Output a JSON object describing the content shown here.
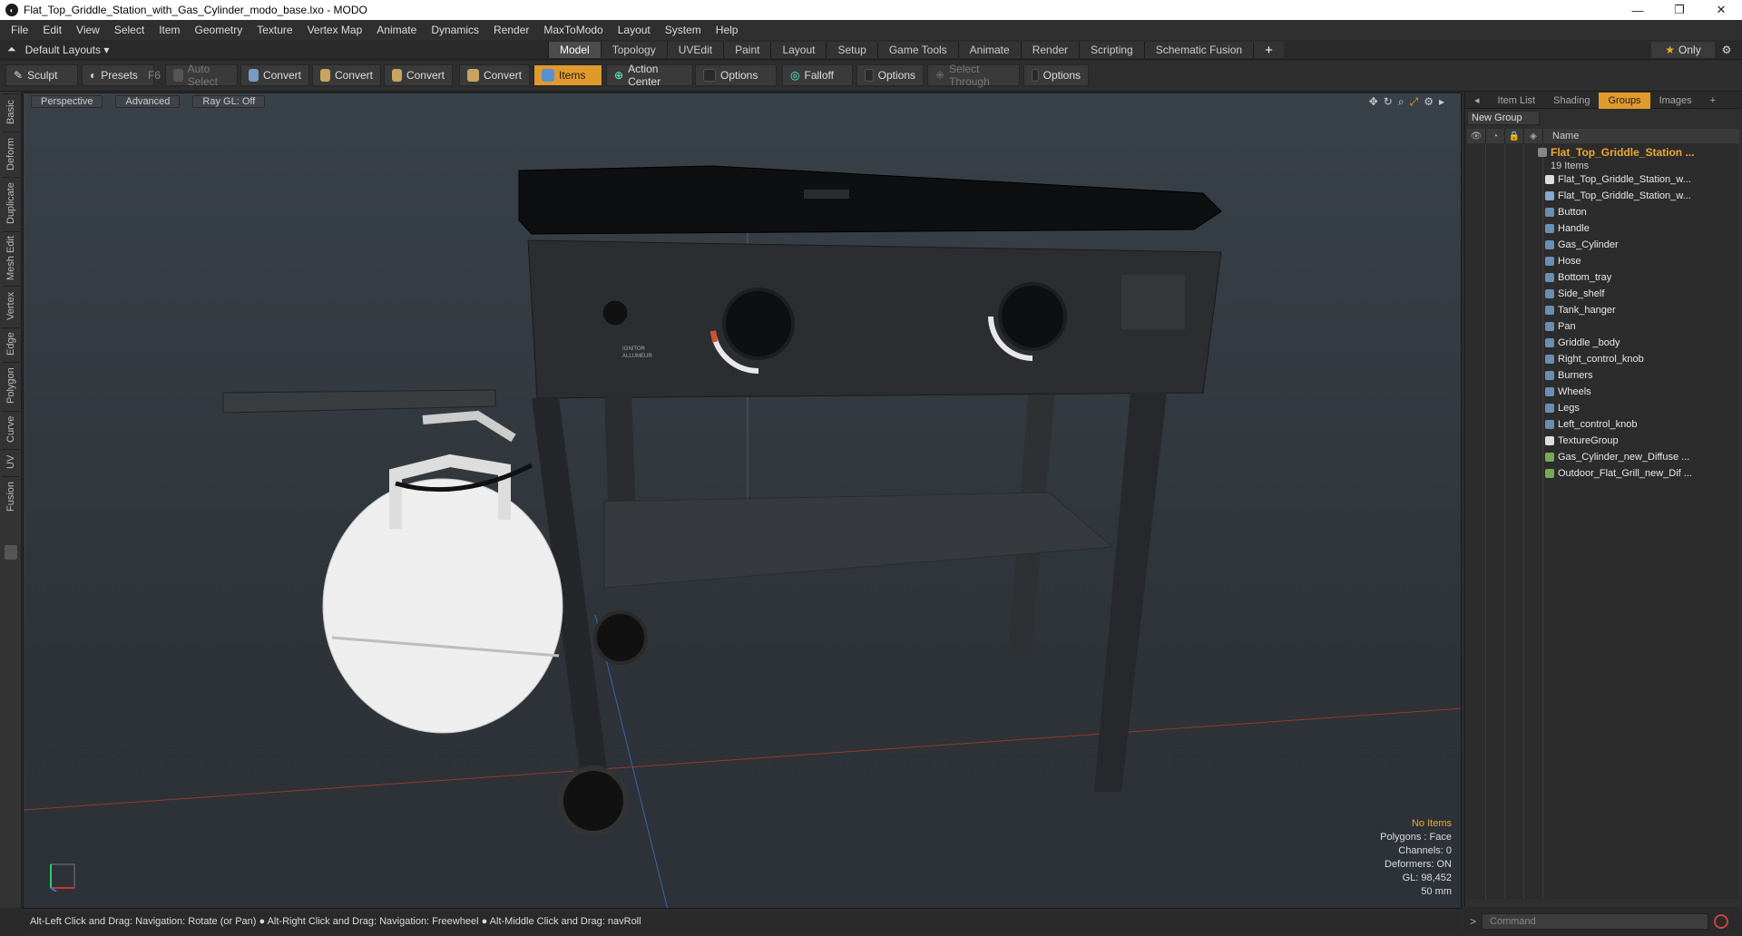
{
  "window": {
    "title": "Flat_Top_Griddle_Station_with_Gas_Cylinder_modo_base.lxo - MODO",
    "controls": [
      "—",
      "❐",
      "✕"
    ]
  },
  "menu": [
    "File",
    "Edit",
    "View",
    "Select",
    "Item",
    "Geometry",
    "Texture",
    "Vertex Map",
    "Animate",
    "Dynamics",
    "Render",
    "MaxToModo",
    "Layout",
    "System",
    "Help"
  ],
  "layout": {
    "label": "Default Layouts",
    "tabs": [
      "Model",
      "Topology",
      "UVEdit",
      "Paint",
      "Layout",
      "Setup",
      "Game Tools",
      "Animate",
      "Render",
      "Scripting",
      "Schematic Fusion"
    ],
    "active_tab": "Model",
    "only_label": "Only"
  },
  "toolbar": {
    "sculpt": "Sculpt",
    "presets": "Presets",
    "presets_key": "F6",
    "auto_select": "Auto Select",
    "convert1": "Convert",
    "convert2": "Convert",
    "convert3": "Convert",
    "convert4": "Convert",
    "items": "Items",
    "action_center": "Action Center",
    "options1": "Options",
    "falloff": "Falloff",
    "options2": "Options",
    "select_through": "Select Through",
    "options3": "Options"
  },
  "left_tabs": [
    "Basic",
    "Deform",
    "Duplicate",
    "Mesh Edit",
    "Vertex",
    "Edge",
    "Polygon",
    "Curve",
    "UV",
    "Fusion"
  ],
  "viewport": {
    "view_mode": "Perspective",
    "shading": "Advanced",
    "raygl": "Ray GL: Off",
    "stats": {
      "selection": "No Items",
      "polygons": "Polygons : Face",
      "channels": "Channels: 0",
      "deformers": "Deformers: ON",
      "gl": "GL: 98,452",
      "size": "50 mm"
    },
    "decal": {
      "ignitor": "IGNITOR",
      "allumeur": "ALLUMEUR"
    }
  },
  "status": "Alt-Left Click and Drag: Navigation: Rotate (or Pan) ● Alt-Right Click and Drag: Navigation: Freewheel ● Alt-Middle Click and Drag: navRoll",
  "panel": {
    "tabs": [
      "Item List",
      "Shading",
      "Groups",
      "Images"
    ],
    "active_tab": "Groups",
    "new_group": "New Group",
    "name_col": "Name",
    "group_name": "Flat_Top_Griddle_Station ...",
    "group_count": "19 Items",
    "items": [
      "Flat_Top_Griddle_Station_w...",
      "Flat_Top_Griddle_Station_w...",
      "Button",
      "Handle",
      "Gas_Cylinder",
      "Hose",
      "Bottom_tray",
      "Side_shelf",
      "Tank_hanger",
      "Pan",
      "Griddle _body",
      "Right_control_knob",
      "Burners",
      "Wheels",
      "Legs",
      "Left_control_knob",
      "TextureGroup",
      "Gas_Cylinder_new_Diffuse ...",
      "Outdoor_Flat_Grill_new_Dif ..."
    ]
  },
  "command": {
    "placeholder": "Command"
  }
}
